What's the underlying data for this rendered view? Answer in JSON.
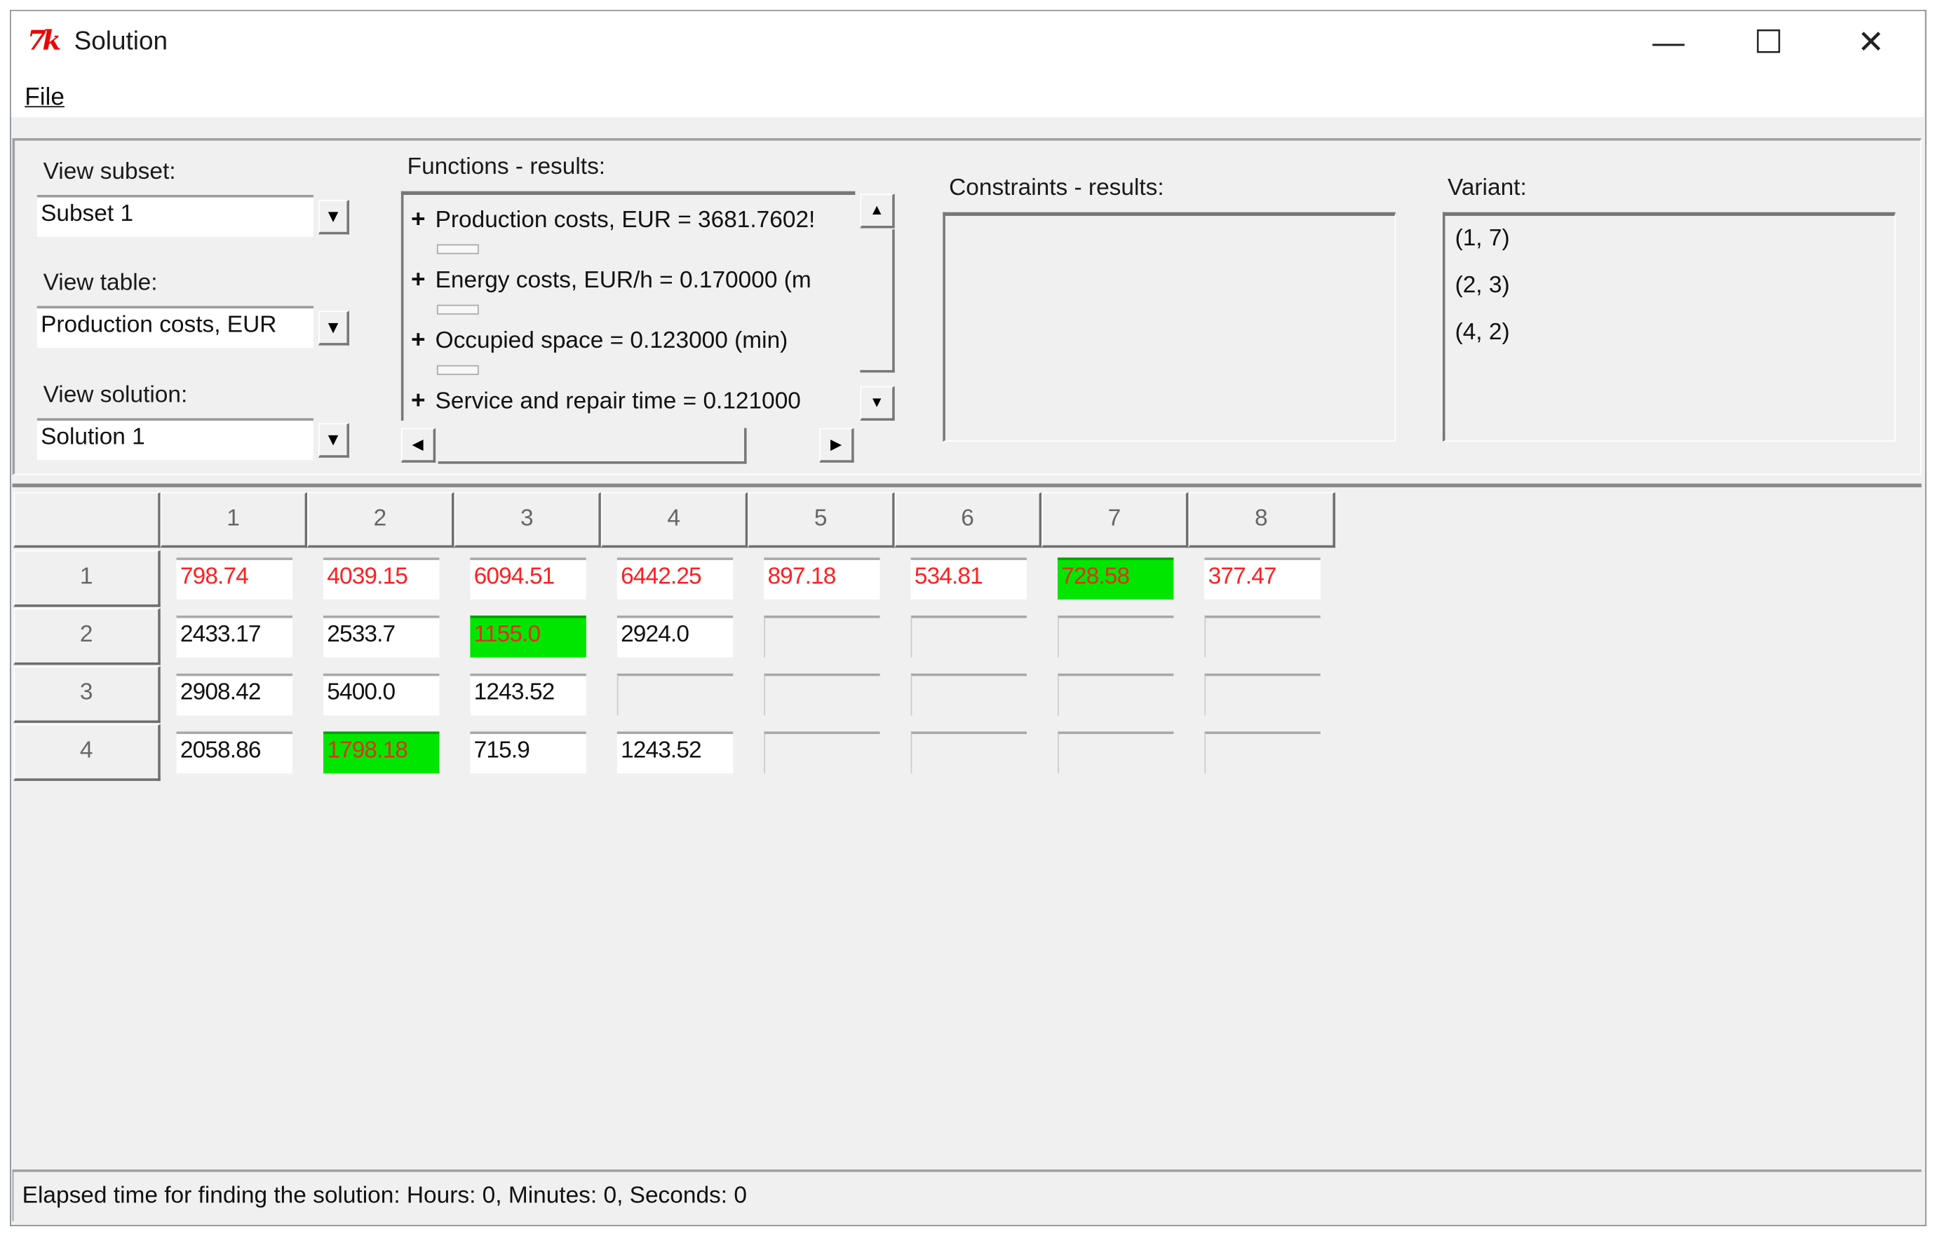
{
  "window": {
    "title": "Solution",
    "icon": "tk-feather-icon"
  },
  "menu": {
    "file": "File"
  },
  "controls": {
    "view_subset_label": "View subset:",
    "view_subset_value": "Subset 1",
    "view_table_label": "View table:",
    "view_table_value": "Production costs, EUR",
    "view_solution_label": "View solution:",
    "view_solution_value": "Solution 1"
  },
  "functions": {
    "label": "Functions - results:",
    "items": [
      "Production costs, EUR = 3681.7602!",
      "Energy costs, EUR/h = 0.170000 (m",
      "Occupied space = 0.123000 (min)",
      "Service and repair time = 0.121000"
    ]
  },
  "constraints": {
    "label": "Constraints - results:"
  },
  "variant": {
    "label": "Variant:",
    "items": [
      "(1, 7)",
      "(2, 3)",
      "(4, 2)"
    ]
  },
  "grid": {
    "columns": [
      "1",
      "2",
      "3",
      "4",
      "5",
      "6",
      "7",
      "8"
    ],
    "rows": [
      {
        "label": "1",
        "cells": [
          "798.74",
          "4039.15",
          "6094.51",
          "6442.25",
          "897.18",
          "534.81",
          "728.58",
          "377.47"
        ],
        "red": true
      },
      {
        "label": "2",
        "cells": [
          "2433.17",
          "2533.7",
          "1155.0",
          "2924.0",
          "",
          "",
          "",
          ""
        ],
        "red": false
      },
      {
        "label": "3",
        "cells": [
          "2908.42",
          "5400.0",
          "1243.52",
          "",
          "",
          "",
          "",
          ""
        ],
        "red": false
      },
      {
        "label": "4",
        "cells": [
          "2058.86",
          "1798.18",
          "715.9",
          "1243.52",
          "",
          "",
          "",
          ""
        ],
        "red": false
      }
    ],
    "highlighted": [
      [
        0,
        6
      ],
      [
        1,
        2
      ],
      [
        3,
        1
      ]
    ],
    "colors": {
      "highlight_bg": "#00e600",
      "highlight_text": "#e03020",
      "red_text": "#ff2020",
      "normal_text": "#111111"
    }
  },
  "status": "Elapsed time for finding the solution: Hours: 0, Minutes: 0, Seconds: 0"
}
